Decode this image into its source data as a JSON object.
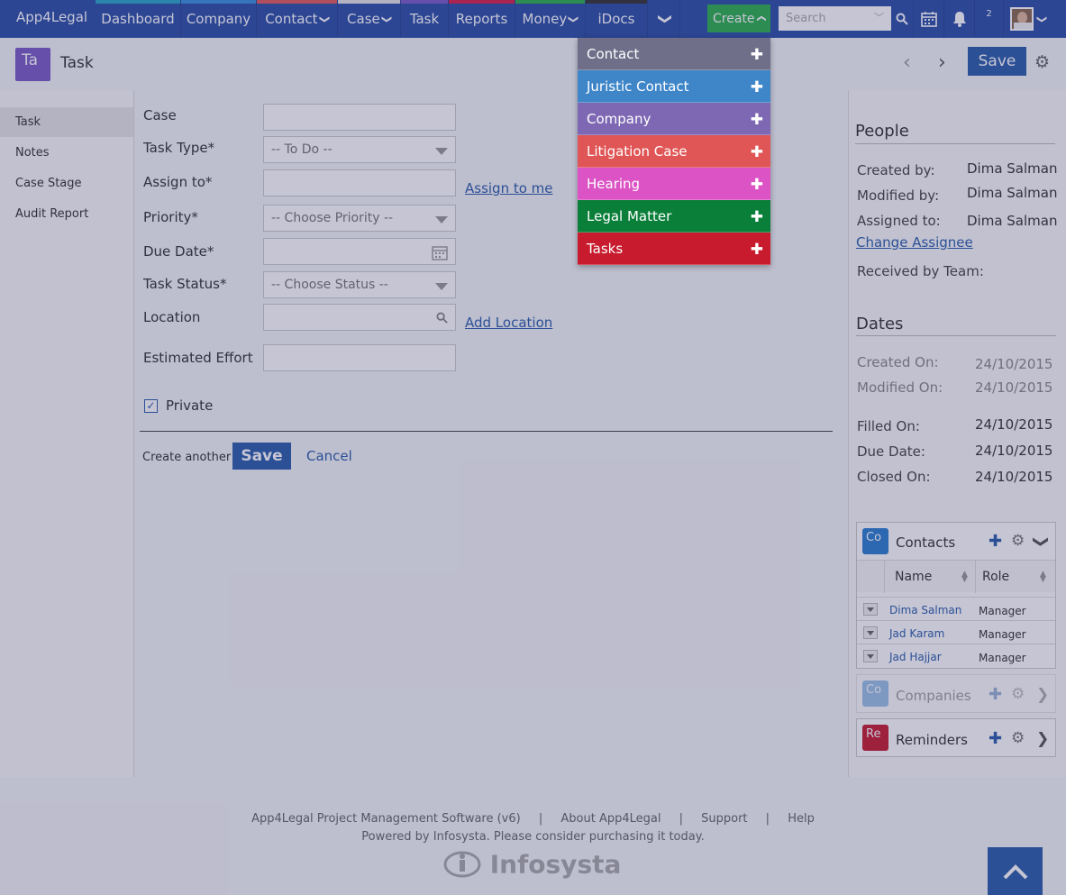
{
  "brand": "App4Legal",
  "nav": [
    {
      "label": "Dashboard",
      "bar": "#2aa7c9"
    },
    {
      "label": "Company",
      "bar": "#3a8fde"
    },
    {
      "label": "Contact",
      "bar": "#e45b5b",
      "chev": "❯"
    },
    {
      "label": "Case",
      "bar": "#e6e6e6",
      "chev": "❯"
    },
    {
      "label": "Task",
      "bar": "#7b5cc5"
    },
    {
      "label": "Reports",
      "bar": "#d8204a"
    },
    {
      "label": "Money",
      "bar": "#2db04b",
      "chev": "❯"
    },
    {
      "label": "iDocs",
      "bar": "#333333"
    }
  ],
  "more_chev": "❯",
  "create": {
    "label": "Create",
    "chev": "❯"
  },
  "search": {
    "placeholder": "Search",
    "caret": "﹀"
  },
  "notifications_count": "2",
  "header": {
    "avatar": "Ta",
    "title": "Task",
    "prev": "‹",
    "next": "›",
    "save": "Save",
    "gear": "⚙"
  },
  "sidebar": [
    {
      "label": "Task",
      "active": true
    },
    {
      "label": "Notes"
    },
    {
      "label": "Case Stage"
    },
    {
      "label": "Audit Report"
    }
  ],
  "form": {
    "case_label": "Case",
    "case_value": "",
    "task_type_label": "Task Type*",
    "task_type_value": "-- To Do --",
    "assign_label": "Assign to*",
    "assign_value": "",
    "assign_link": "Assign to me",
    "priority_label": "Priority*",
    "priority_value": "-- Choose Priority --",
    "due_label": "Due Date*",
    "due_value": "",
    "status_label": "Task Status*",
    "status_value": "-- Choose Status --",
    "location_label": "Location",
    "location_value": "",
    "location_link": "Add Location",
    "effort_label": "Estimated Effort",
    "effort_value": "",
    "private_label": "Private",
    "private_checked": "✓",
    "create_another": "Create another",
    "save": "Save",
    "cancel": "Cancel"
  },
  "people": {
    "title": "People",
    "created_by_label": "Created by:",
    "created_by": "Dima Salman",
    "modified_by_label": "Modified by:",
    "modified_by": "Dima Salman",
    "assigned_to_label": "Assigned to:",
    "assigned_to": "Dima Salman",
    "change_assignee": "Change Assignee",
    "received_by_label": "Received by Team:"
  },
  "dates": {
    "title": "Dates",
    "created_on_label": "Created On:",
    "created_on": "24/10/2015",
    "modified_on_label": "Modified On:",
    "modified_on": "24/10/2015",
    "filled_on_label": "Filled On:",
    "filled_on": "24/10/2015",
    "due_date_label": "Due Date:",
    "due_date": "24/10/2015",
    "closed_on_label": "Closed On:",
    "closed_on": "24/10/2015"
  },
  "contacts_panel": {
    "icon": "Co",
    "title": "Contacts",
    "col_name": "Name",
    "col_role": "Role",
    "rows": [
      {
        "name": "Dima Salman",
        "role": "Manager"
      },
      {
        "name": "Jad Karam",
        "role": "Manager"
      },
      {
        "name": "Jad Hajjar",
        "role": "Manager"
      }
    ]
  },
  "companies_panel": {
    "icon": "Co",
    "title": "Companies"
  },
  "reminders_panel": {
    "icon": "Re",
    "title": "Reminders"
  },
  "create_menu": [
    {
      "label": "Contact",
      "color": "#6f6f8a"
    },
    {
      "label": "Juristic Contact",
      "color": "#3f86c9"
    },
    {
      "label": "Company",
      "color": "#7e68b4"
    },
    {
      "label": "Litigation Case",
      "color": "#e05555"
    },
    {
      "label": "Hearing",
      "color": "#db53c4"
    },
    {
      "label": "Legal Matter",
      "color": "#0a7f3a"
    },
    {
      "label": "Tasks",
      "color": "#c81b2e"
    }
  ],
  "footer": {
    "line1_a": "App4Legal Project Management Software (v6)",
    "sep": "|",
    "line1_b": "About App4Legal",
    "line1_c": "Support",
    "line1_d": "Help",
    "line2": "Powered by Infosysta. Please consider purchasing it today.",
    "logo": "Infosysta"
  }
}
